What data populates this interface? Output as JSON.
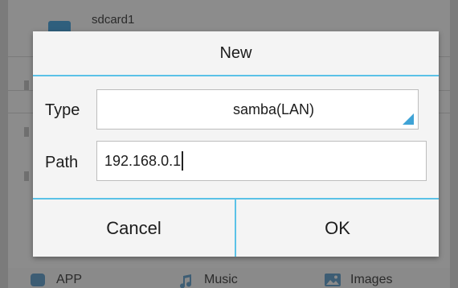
{
  "background": {
    "storage_item_label": "sdcard1",
    "bottom_nav": [
      {
        "label": "APP",
        "icon": "app-icon"
      },
      {
        "label": "Music",
        "icon": "music-note-icon"
      },
      {
        "label": "Images",
        "icon": "image-icon"
      }
    ]
  },
  "dialog": {
    "title": "New",
    "type_label": "Type",
    "type_value": "samba(LAN)",
    "path_label": "Path",
    "path_value": "192.168.0.1",
    "cancel_label": "Cancel",
    "ok_label": "OK"
  },
  "colors": {
    "accent": "#5bc2e7",
    "dropdown_arrow": "#3fa3d6",
    "dialog_bg": "#f4f4f4",
    "scrim_bg": "#7b7b7b"
  }
}
